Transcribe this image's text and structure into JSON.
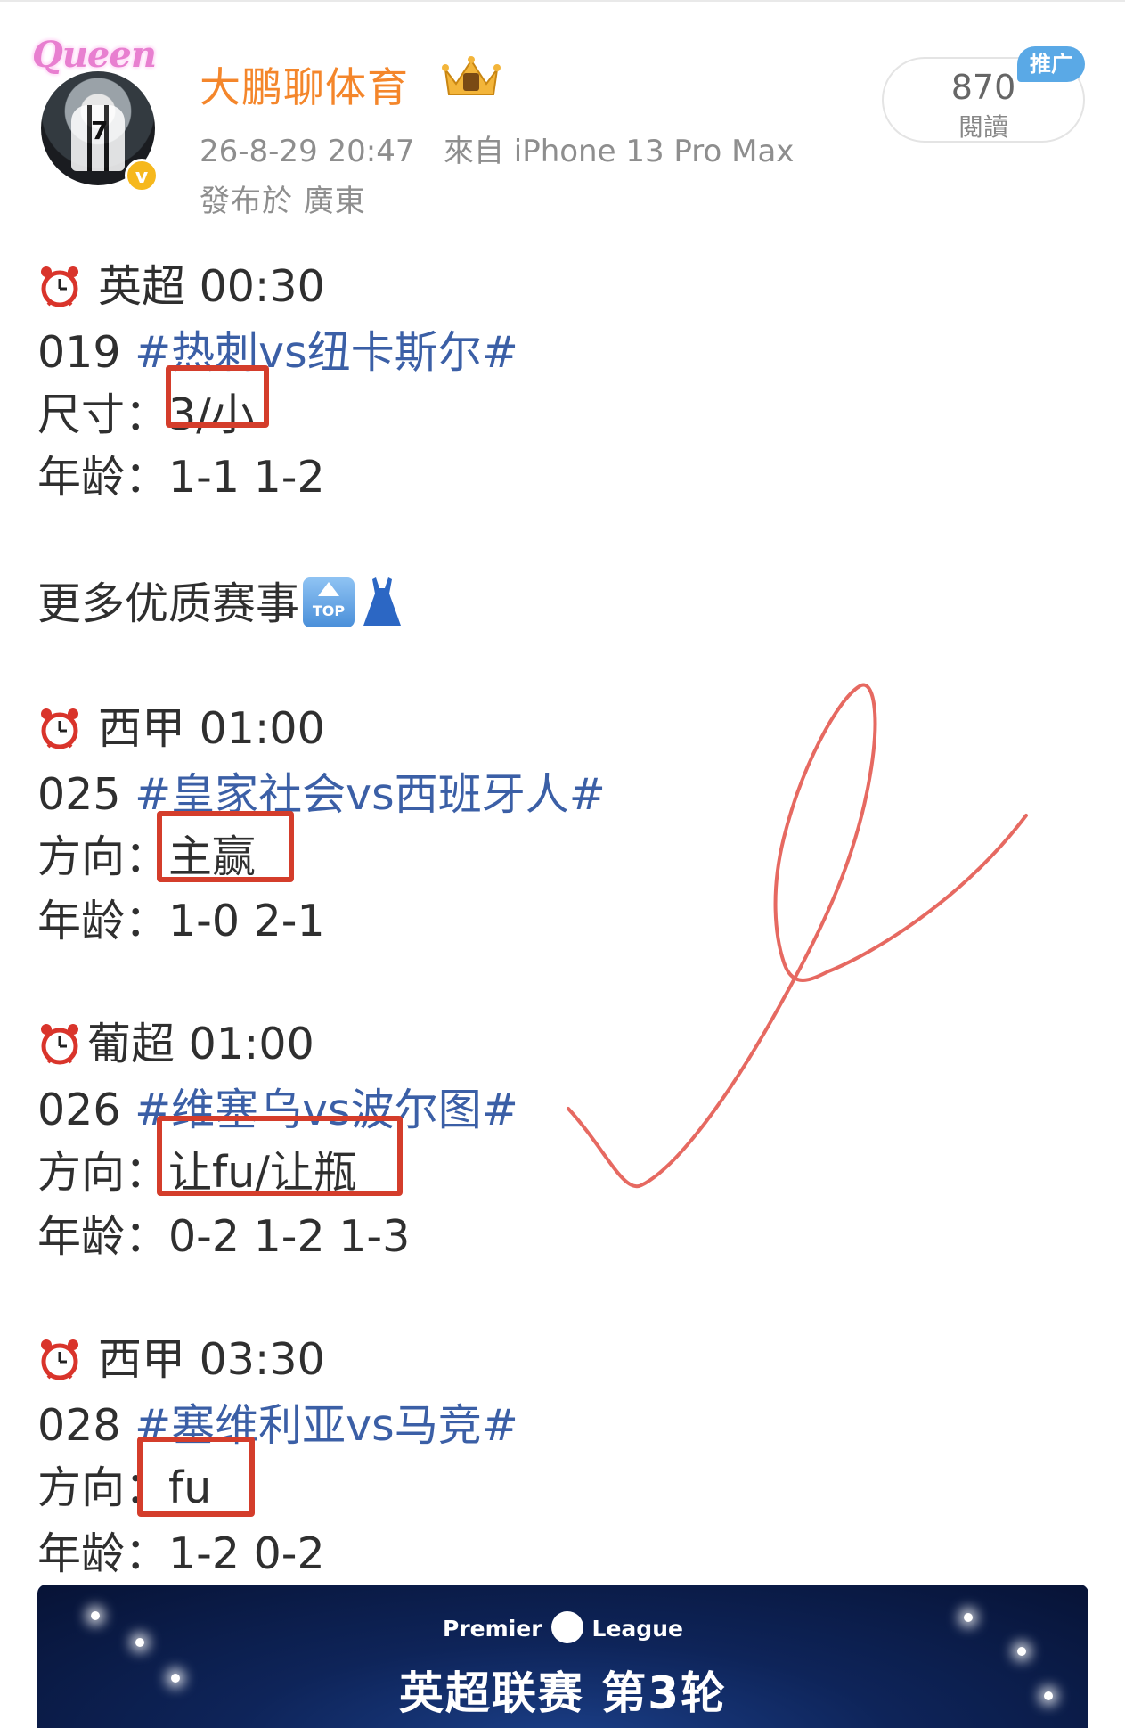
{
  "header": {
    "username": "大鹏聊体育",
    "avatar_text": "Queen",
    "verified_icon": "verified-badge-icon",
    "crown_icon": "crown-icon",
    "timestamp": "26-8-29 20:47",
    "source": "來自 iPhone 13 Pro Max",
    "location": "發布於 廣東",
    "reads_count": "870",
    "reads_label": "閱讀",
    "promo_badge": "推广"
  },
  "post": {
    "match1": {
      "header": "英超 00:30",
      "id": "019",
      "hashtag": "#热刺vs纽卡斯尔#",
      "pick_label": "尺寸：",
      "pick_value": "3/小",
      "scores": "年龄：1-1 1-2"
    },
    "promo_line": "更多优质赛事",
    "top_emoji_text": "TOP",
    "match2": {
      "header": "西甲 01:00",
      "id": "025",
      "hashtag": "#皇家社会vs西班牙人#",
      "pick_label": "方向：",
      "pick_value": "主赢",
      "scores": "年龄：1-0 2-1"
    },
    "match3": {
      "header": "葡超 01:00",
      "id": "026",
      "hashtag": "#维塞乌vs波尔图#",
      "pick_label": "方向：",
      "pick_value": "让fu/让瓶",
      "scores": "年龄：0-2 1-2 1-3"
    },
    "match4": {
      "header": "西甲 03:30",
      "id": "028",
      "hashtag": "#塞维利亚vs马竞#",
      "pick_label": "方向",
      "pick_value": "：fu",
      "scores": "年龄：1-2 0-2"
    }
  },
  "banner": {
    "league_left": "Premier",
    "league_right": "League",
    "title": "英超联赛 第3轮"
  },
  "colors": {
    "username": "#f4862b",
    "hashtag": "#3b5fa6",
    "highlight_box": "#d43d2b",
    "signature": "#e0443a"
  }
}
